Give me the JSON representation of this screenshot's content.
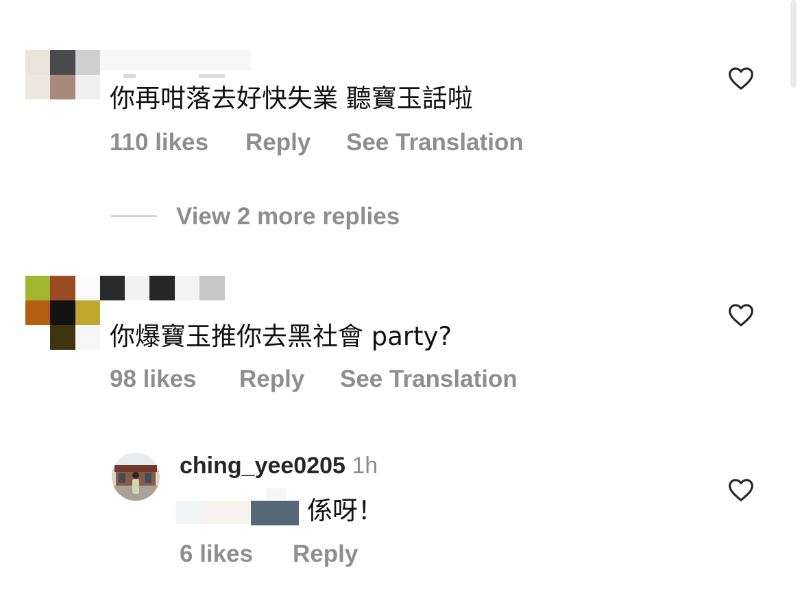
{
  "comments": [
    {
      "text": "你再咁落去好快失業 聽寶玉話啦",
      "likes": "110 likes",
      "reply": "Reply",
      "translate": "See Translation",
      "view_replies": "View 2 more replies"
    },
    {
      "text": "你爆寶玉推你去黑社會 party?",
      "likes": "98 likes",
      "reply": "Reply",
      "translate": "See Translation"
    }
  ],
  "reply": {
    "username": "ching_yee0205",
    "time": "1h",
    "text": "係呀！",
    "likes": "6 likes",
    "reply": "Reply"
  },
  "icons": {
    "like": "heart-outline-icon"
  },
  "colors": {
    "text": "#262626",
    "secondary": "#8e8e8e"
  }
}
